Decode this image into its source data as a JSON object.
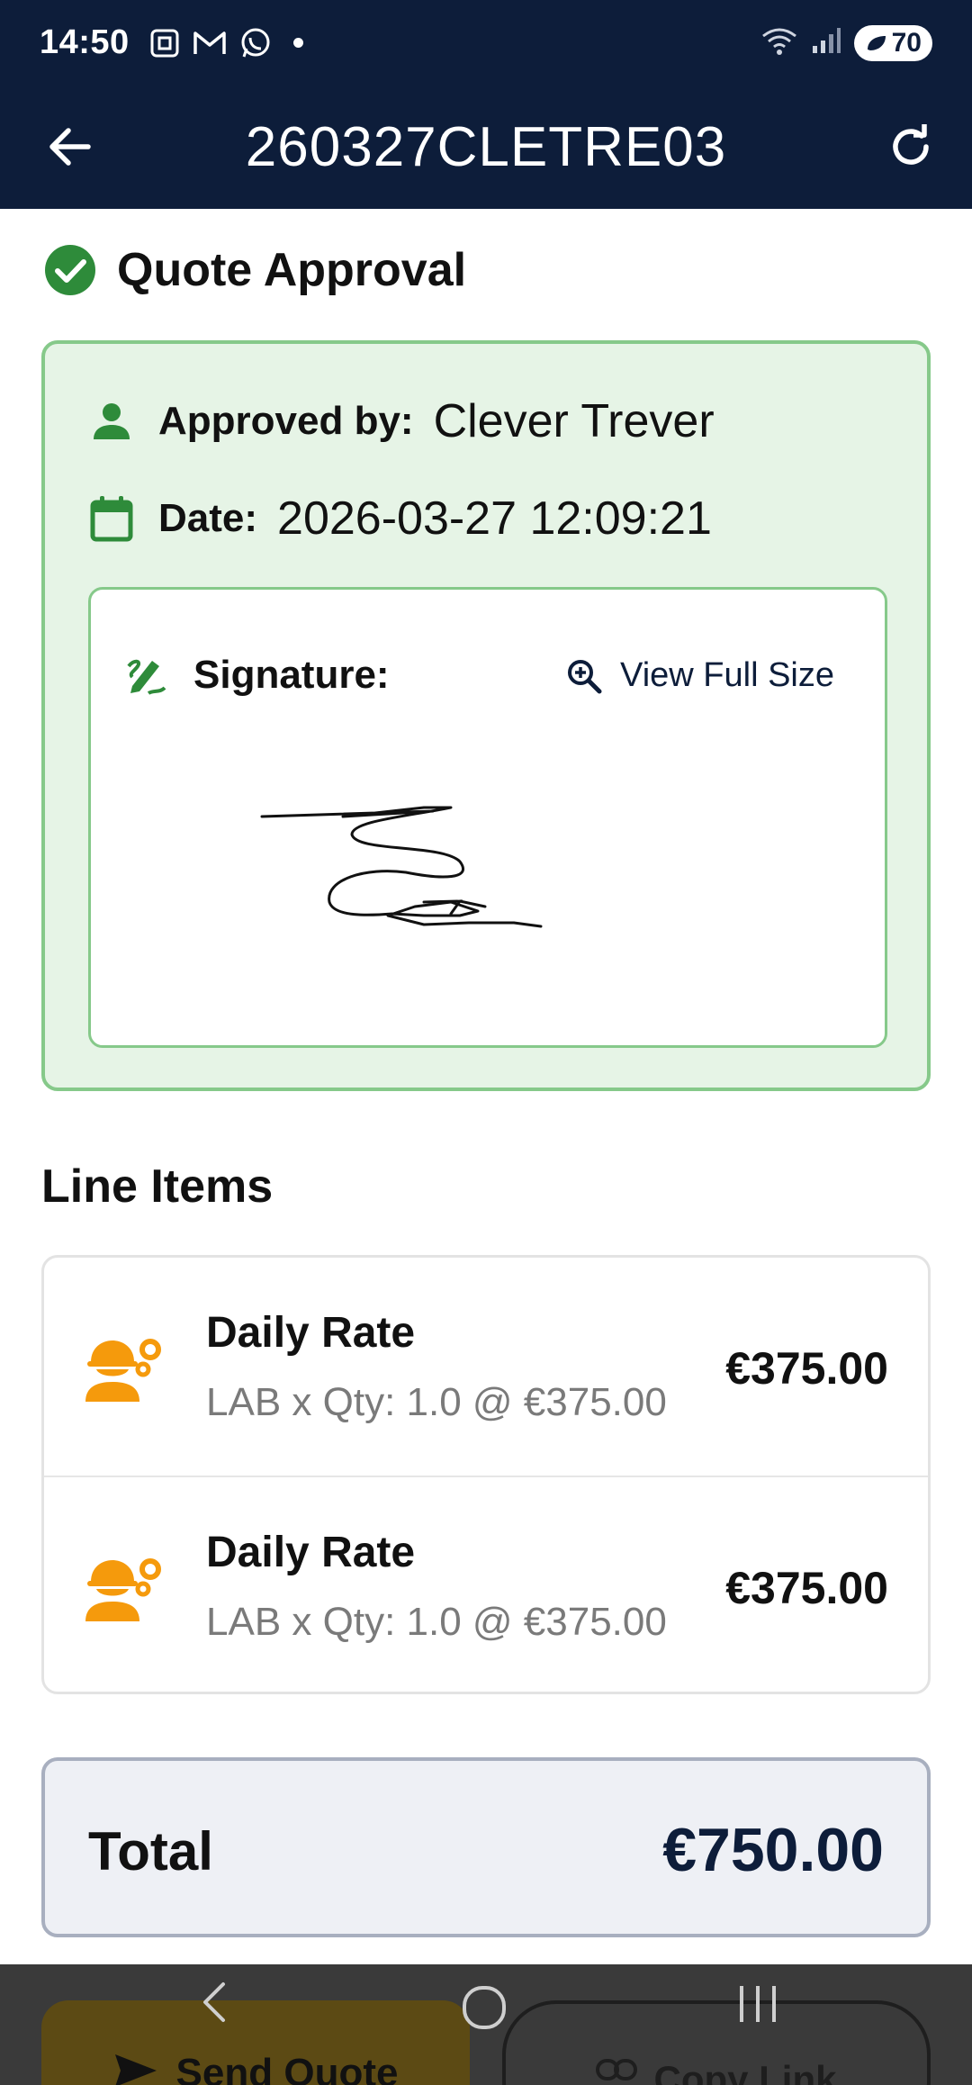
{
  "status_bar": {
    "time": "14:50",
    "battery": "70",
    "icons": [
      "screenshot-icon",
      "gmail-icon",
      "whatsapp-icon",
      "dot-icon",
      "wifi-icon",
      "signal-icon",
      "battery-icon"
    ]
  },
  "app_bar": {
    "title": "260327CLETRE03",
    "back_icon": "arrow-back-icon",
    "refresh_icon": "refresh-icon"
  },
  "approval": {
    "section_title": "Quote Approval",
    "approved_by_label": "Approved by:",
    "approved_by_value": "Clever Trever",
    "date_label": "Date:",
    "date_value": "2026-03-27 12:09:21",
    "signature_label": "Signature:",
    "view_full_label": "View Full Size"
  },
  "line_items": {
    "title": "Line Items",
    "items": [
      {
        "name": "Daily Rate",
        "detail": "LAB x Qty: 1.0 @ €375.00",
        "amount": "€375.00"
      },
      {
        "name": "Daily Rate",
        "detail": "LAB x Qty: 1.0 @ €375.00",
        "amount": "€375.00"
      }
    ]
  },
  "total": {
    "label": "Total",
    "amount": "€750.00"
  },
  "actions": {
    "send_label": "Send Quote",
    "copy_label": "Copy Link"
  },
  "colors": {
    "header_bg": "#0d1d3a",
    "approval_green": "#2e8b3a",
    "approval_bg": "#e6f4e6",
    "labor_orange": "#f59a0c",
    "total_bg": "#eef0f5"
  }
}
